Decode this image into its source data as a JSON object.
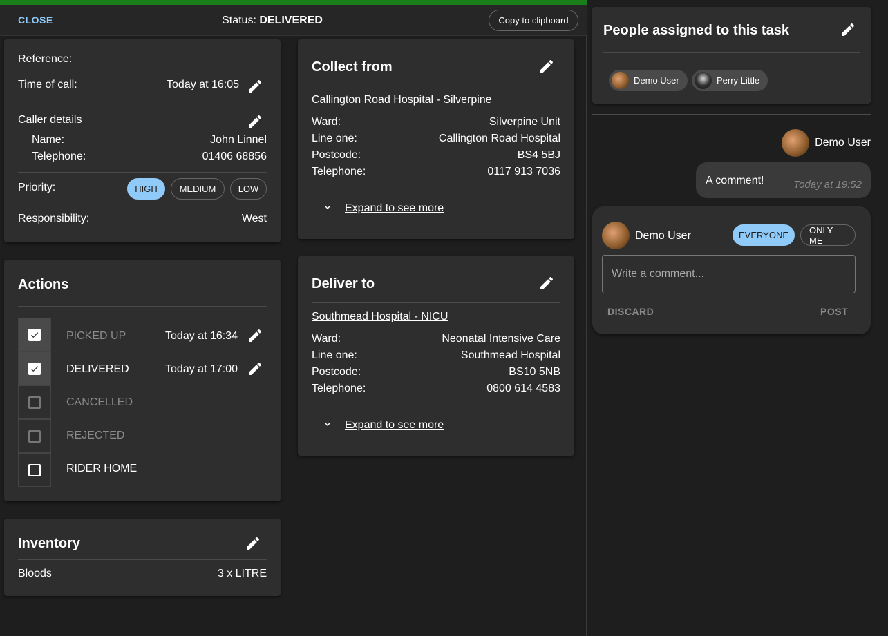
{
  "topbar": {
    "close_label": "CLOSE",
    "status_prefix": "Status: ",
    "status_value": "DELIVERED",
    "copy_label": "Copy to clipboard"
  },
  "details": {
    "reference_label": "Reference:",
    "reference_value": "",
    "time_label": "Time of call:",
    "time_value": "Today at 16:05",
    "caller_label": "Caller details",
    "name_label": "Name:",
    "name_value": "John Linnel",
    "phone_label": "Telephone:",
    "phone_value": "01406 68856",
    "priority_label": "Priority:",
    "priority_options": [
      "HIGH",
      "MEDIUM",
      "LOW"
    ],
    "priority_selected": "HIGH",
    "responsibility_label": "Responsibility:",
    "responsibility_value": "West"
  },
  "actions": {
    "title": "Actions",
    "items": [
      {
        "label": "PICKED UP",
        "time": "Today at 16:34",
        "checked": true,
        "disabled": true
      },
      {
        "label": "DELIVERED",
        "time": "Today at 17:00",
        "checked": true,
        "disabled": false
      },
      {
        "label": "CANCELLED",
        "time": "",
        "checked": false,
        "disabled": true
      },
      {
        "label": "REJECTED",
        "time": "",
        "checked": false,
        "disabled": true
      },
      {
        "label": "RIDER HOME",
        "time": "",
        "checked": false,
        "disabled": false
      }
    ]
  },
  "inventory": {
    "title": "Inventory",
    "item_label": "Bloods",
    "item_value": "3 x LITRE"
  },
  "collect": {
    "title": "Collect from",
    "location_link": "Callington Road Hospital - Silverpine",
    "ward_label": "Ward:",
    "ward_value": "Silverpine Unit",
    "line_label": "Line one:",
    "line_value": "Callington Road Hospital",
    "postcode_label": "Postcode:",
    "postcode_value": "BS4 5BJ",
    "phone_label": "Telephone:",
    "phone_value": "0117 913 7036",
    "expand_label": "Expand to see more"
  },
  "deliver": {
    "title": "Deliver to",
    "location_link": "Southmead Hospital - NICU",
    "ward_label": "Ward:",
    "ward_value": "Neonatal Intensive Care",
    "line_label": "Line one:",
    "line_value": "Southmead Hospital",
    "postcode_label": "Postcode:",
    "postcode_value": "BS10 5NB",
    "phone_label": "Telephone:",
    "phone_value": "0800 614 4583",
    "expand_label": "Expand to see more"
  },
  "assigned": {
    "title": "People assigned to this task",
    "people": [
      "Demo User",
      "Perry Little"
    ]
  },
  "comments": {
    "author": "Demo User",
    "text": "A comment!",
    "time": "Today at 19:52"
  },
  "composer": {
    "author": "Demo User",
    "visibility_options": [
      "EVERYONE",
      "ONLY ME"
    ],
    "visibility_selected": "EVERYONE",
    "placeholder": "Write a comment...",
    "discard_label": "DISCARD",
    "post_label": "POST"
  },
  "colors": {
    "accent": "#90caf9",
    "progress": "#1a7f1a",
    "card": "#2e2e2e",
    "background": "#1e1e1e"
  },
  "progress_fraction": 1.0
}
